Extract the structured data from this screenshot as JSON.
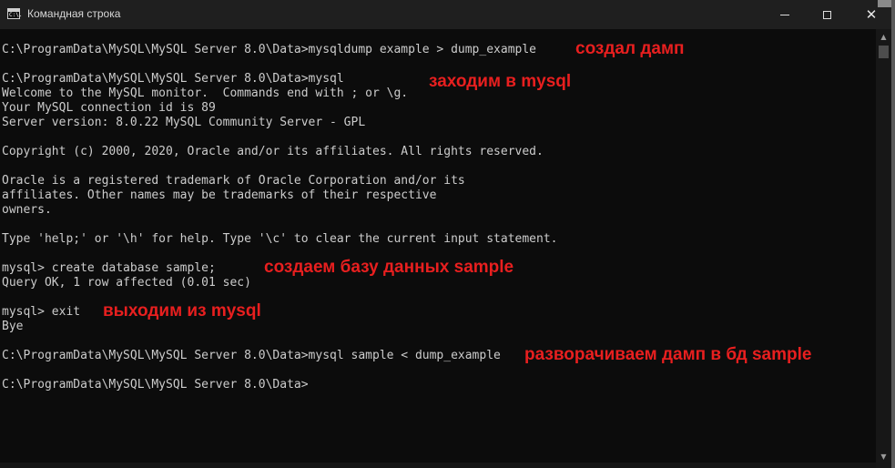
{
  "window": {
    "title": "Командная строка",
    "icon": "cmd-icon",
    "icon_text": "C:\\.",
    "buttons": {
      "minimize": "minimize-icon",
      "maximize": "maximize-icon",
      "close": "close-icon",
      "close_glyph": "✕"
    }
  },
  "console": {
    "lines": [
      "C:\\ProgramData\\MySQL\\MySQL Server 8.0\\Data>mysqldump example > dump_example",
      "C:\\ProgramData\\MySQL\\MySQL Server 8.0\\Data>mysql",
      "Welcome to the MySQL monitor.  Commands end with ; or \\g.",
      "Your MySQL connection id is 89",
      "Server version: 8.0.22 MySQL Community Server - GPL",
      "Copyright (c) 2000, 2020, Oracle and/or its affiliates. All rights reserved.",
      "Oracle is a registered trademark of Oracle Corporation and/or its",
      "affiliates. Other names may be trademarks of their respective",
      "owners.",
      "Type 'help;' or '\\h' for help. Type '\\c' to clear the current input statement.",
      "mysql> create database sample;",
      "Query OK, 1 row affected (0.01 sec)",
      "mysql> exit",
      "Bye",
      "C:\\ProgramData\\MySQL\\MySQL Server 8.0\\Data>mysql sample < dump_example",
      "C:\\ProgramData\\MySQL\\MySQL Server 8.0\\Data>"
    ]
  },
  "annotations": {
    "color": "#e81f1f",
    "items": [
      "создал дамп",
      "заходим в mysql",
      "создаем базу данных sample",
      "выходим из mysql",
      "разворачиваем дамп в бд sample"
    ]
  },
  "colors": {
    "console_background": "#0c0c0c",
    "console_text": "#cccccc",
    "titlebar": "#1f1f1f"
  }
}
